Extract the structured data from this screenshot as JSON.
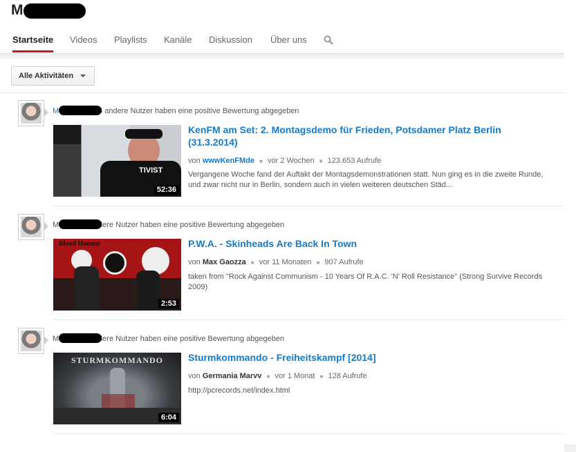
{
  "header": {
    "channel_name": "M    H",
    "tabs": [
      "Startseite",
      "Videos",
      "Playlists",
      "Kanäle",
      "Diskussion",
      "Über uns"
    ],
    "search_icon": "search-icon"
  },
  "filter": {
    "label": "Alle Aktivitäten"
  },
  "items": [
    {
      "user": "M   H",
      "activity_text": "und 4.276 andere Nutzer haben eine positive Bewertung abgegeben",
      "title": "KenFM am Set: 2. Montagsdemo für Frieden, Potsdamer Platz Berlin (31.3.2014)",
      "by": "von",
      "uploader": "wwwKenFMde",
      "age": "vor 2 Wochen",
      "views": "123.653 Aufrufe",
      "description": "Vergangene Woche fand der Auftakt der Montagsdemonstrationen statt. Nun ging es in die zweite Runde, und zwar nicht nur in Berlin, sondern auch in vielen weiteren deutschen Städ...",
      "duration": "52:36",
      "thumb_text": "TIVIST"
    },
    {
      "user": "M   H",
      "activity_text": "und 9 andere Nutzer haben eine positive Bewertung abgegeben",
      "title": "P.W.A. - Skinheads Are Back In Town",
      "by": "von",
      "uploader": "Max Gaozza",
      "age": "vor 11 Monaten",
      "views": "907 Aufrufe",
      "description": "taken from \"Rock Against Communism - 10 Years Of R.A.C. 'N' Roll Resistance\" (Strong Survive Records 2009)",
      "duration": "2:53",
      "thumb_text": "Blood Honour"
    },
    {
      "user": "M   H",
      "activity_text": "und 3 andere Nutzer haben eine positive Bewertung abgegeben",
      "title": "Sturmkommando - Freiheitskampf [2014]",
      "by": "von",
      "uploader": "Germania Marvv",
      "age": "vor 1 Monat",
      "views": "128 Aufrufe",
      "description": "http://pcrecords.net/index.html",
      "duration": "6:04",
      "thumb_text": "STURMKOMMANDO"
    }
  ],
  "colors": {
    "accent": "#cc181e",
    "link": "#167ac6"
  }
}
